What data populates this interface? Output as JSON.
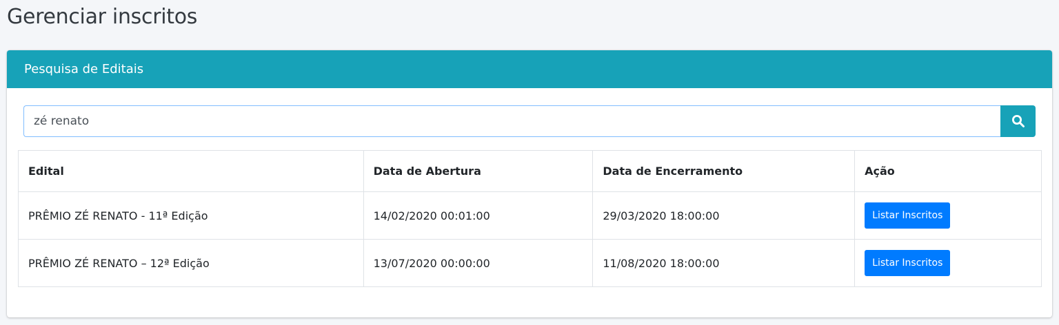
{
  "page": {
    "title": "Gerenciar inscritos"
  },
  "card": {
    "header": "Pesquisa de Editais"
  },
  "search": {
    "value": "zé renato",
    "button_icon": "search-icon"
  },
  "table": {
    "headers": [
      "Edital",
      "Data de Abertura",
      "Data de Encerramento",
      "Ação"
    ],
    "rows": [
      {
        "edital": "PRÊMIO ZÉ RENATO - 11ª Edição",
        "abertura": "14/02/2020 00:01:00",
        "encerramento": "29/03/2020 18:00:00",
        "acao": "Listar Inscritos"
      },
      {
        "edital": "PRÊMIO ZÉ RENATO – 12ª Edição",
        "abertura": "13/07/2020 00:00:00",
        "encerramento": "11/08/2020 18:00:00",
        "acao": "Listar Inscritos"
      }
    ]
  },
  "colors": {
    "header_bg": "#17a2b8",
    "primary_button": "#007bff",
    "page_bg": "#f4f6f9"
  }
}
